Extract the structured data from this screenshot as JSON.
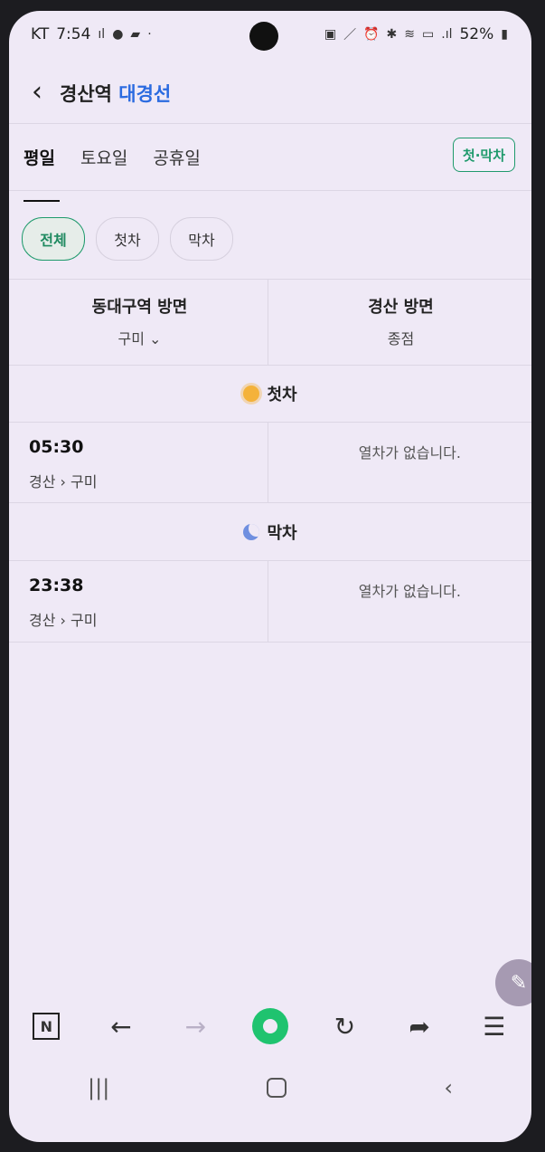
{
  "status_bar": {
    "carrier": "KT",
    "time": "7:54",
    "battery": "52%"
  },
  "header": {
    "station": "경산역",
    "line": "대경선"
  },
  "tabs": [
    {
      "label": "평일",
      "active": true
    },
    {
      "label": "토요일",
      "active": false
    },
    {
      "label": "공휴일",
      "active": false
    }
  ],
  "first_last_button": "첫·막차",
  "filters": [
    {
      "label": "전체",
      "active": true
    },
    {
      "label": "첫차",
      "active": false
    },
    {
      "label": "막차",
      "active": false
    }
  ],
  "directions": {
    "left": {
      "title": "동대구역 방면",
      "subtitle": "구미"
    },
    "right": {
      "title": "경산 방면",
      "subtitle": "종점"
    }
  },
  "sections": {
    "first": {
      "label": "첫차",
      "left": {
        "time": "05:30",
        "from": "경산",
        "to": "구미"
      },
      "right": {
        "message": "열차가 없습니다."
      }
    },
    "last": {
      "label": "막차",
      "left": {
        "time": "23:38",
        "from": "경산",
        "to": "구미"
      },
      "right": {
        "message": "열차가 없습니다."
      }
    }
  },
  "colors": {
    "accent": "#1f9a6c",
    "line_blue": "#2b6be0",
    "background": "#efe9f6"
  }
}
